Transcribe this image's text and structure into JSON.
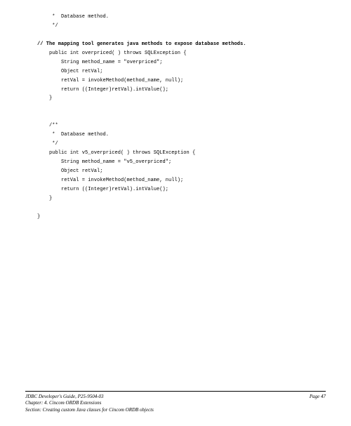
{
  "code": {
    "l01": "         *  Database method.",
    "l02": "         */",
    "l03": "",
    "l04": "    // The mapping tool generates java methods to expose database methods.",
    "l05": "        public int overpriced( ) throws SQLException {",
    "l06": "            String method_name = \"overpriced\";",
    "l07": "            Object retVal;",
    "l08": "            retVal = invokeMethod(method_name, null);",
    "l09": "            return ((Integer)retVal).intValue();",
    "l10": "        }",
    "l11": "",
    "l12": "",
    "l13": "        /**",
    "l14": "         *  Database method.",
    "l15": "         */",
    "l16": "        public int v5_overpriced( ) throws SQLException {",
    "l17": "            String method_name = \"v5_overpriced\";",
    "l18": "            Object retVal;",
    "l19": "            retVal = invokeMethod(method_name, null);",
    "l20": "            return ((Integer)retVal).intValue();",
    "l21": "        }",
    "l22": "",
    "l23": "    }"
  },
  "footer": {
    "guide": "JDBC Developer's Guide, P25-9504-03",
    "chapter": "Chapter: 4. Cincom ORDB Extensions",
    "section": "Section: Creating custom Java classes for Cincom ORDB objects",
    "page": "Page 47"
  }
}
